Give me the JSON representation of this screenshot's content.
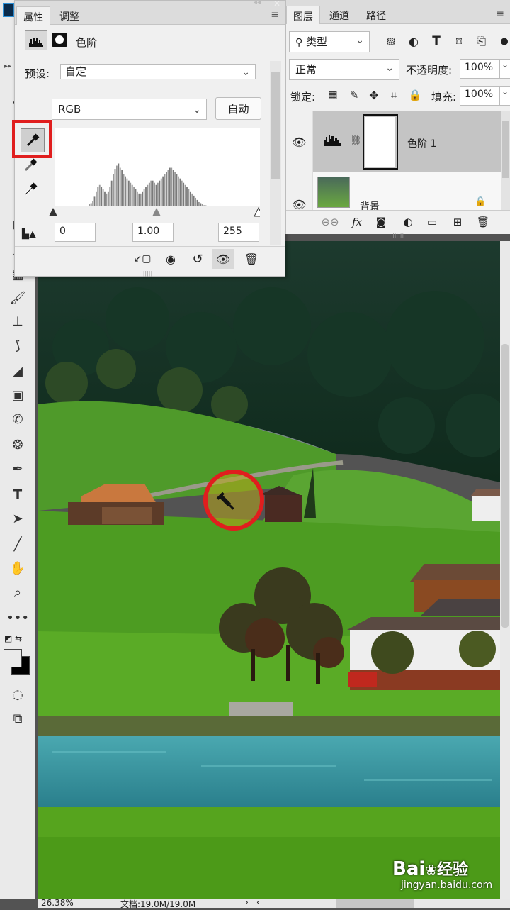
{
  "properties_panel": {
    "tabs": [
      "属性",
      "调整"
    ],
    "adjustment_name": "色阶",
    "preset_label": "预设:",
    "preset_value": "自定",
    "channel_value": "RGB",
    "auto_button": "自动",
    "input_black": "0",
    "input_gamma": "1.00",
    "input_white": "255"
  },
  "layers_panel": {
    "tabs": [
      "图层",
      "通道",
      "路径"
    ],
    "filter_kind": "类型",
    "blend_mode": "正常",
    "opacity_label": "不透明度:",
    "opacity_value": "100%",
    "lock_label": "锁定:",
    "fill_label": "填充:",
    "fill_value": "100%",
    "layers": [
      {
        "name": "色阶 1",
        "selected": true
      },
      {
        "name": "背景",
        "selected": false
      }
    ]
  },
  "status_bar": {
    "zoom": "26.38%",
    "doc_info": "文档:19.0M/19.0M"
  },
  "watermark": {
    "brand": "Bai",
    "brand_cn": "经验",
    "url": "jingyan.baidu.com"
  },
  "histogram": {
    "channel": "RGB",
    "shadow_input": 0,
    "midtone_input": 1.0,
    "highlight_input": 255,
    "bins": [
      0,
      0,
      0,
      0,
      0,
      0,
      0,
      0,
      0,
      0,
      0,
      0,
      0,
      0,
      0,
      0,
      0,
      0,
      0,
      0,
      2,
      3,
      5,
      9,
      14,
      18,
      20,
      18,
      16,
      14,
      12,
      14,
      18,
      24,
      30,
      35,
      38,
      40,
      36,
      34,
      30,
      28,
      26,
      24,
      22,
      20,
      18,
      16,
      14,
      12,
      12,
      14,
      16,
      18,
      20,
      22,
      24,
      24,
      22,
      20,
      22,
      24,
      26,
      28,
      30,
      32,
      34,
      36,
      36,
      34,
      32,
      30,
      28,
      26,
      24,
      22,
      20,
      18,
      16,
      14,
      12,
      10,
      8,
      6,
      4,
      3,
      2,
      1,
      1,
      0,
      0,
      0,
      0,
      0,
      0,
      0,
      0,
      0,
      0,
      0,
      0,
      0,
      0,
      0,
      0,
      0,
      0,
      0,
      0,
      0,
      0,
      0,
      0,
      0,
      0,
      0,
      0,
      0,
      0,
      0
    ]
  },
  "colors": {
    "highlight_red": "#e01e1e",
    "selected_layer": "#c4c4c4",
    "panel_bg": "#f0f0f0"
  }
}
